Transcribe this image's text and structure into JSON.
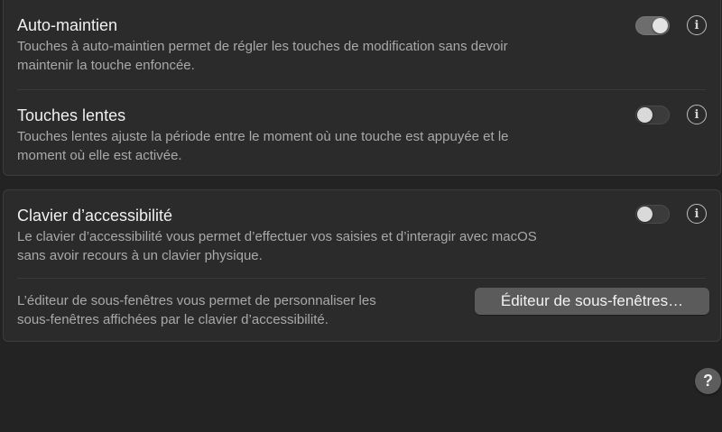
{
  "group1": {
    "sticky_keys": {
      "title": "Auto-maintien",
      "description_line1": "Touches à auto-maintien permet de régler les touches de modification sans devoir",
      "description_line2": "maintenir la touche enfoncée.",
      "enabled": true,
      "info_glyph": "i"
    },
    "slow_keys": {
      "title": "Touches lentes",
      "description_line1": "Touches lentes ajuste la période entre le moment où une touche est appuyée et le",
      "description_line2": "moment où elle est activée.",
      "enabled": false,
      "info_glyph": "i"
    }
  },
  "group2": {
    "accessibility_keyboard": {
      "title": "Clavier d’accessibilité",
      "description_line1": "Le clavier d’accessibilité vous permet d’effectuer vos saisies et d’interagir avec macOS",
      "description_line2": "sans avoir recours à un clavier physique.",
      "enabled": false,
      "info_glyph": "i"
    },
    "panel_editor": {
      "description_line1": "L’éditeur de sous-fenêtres vous permet de personnaliser les",
      "description_line2": "sous-fenêtres affichées par le clavier d’accessibilité.",
      "button_label": "Éditeur de sous-fenêtres…"
    }
  },
  "help": {
    "label": "?"
  },
  "icons": {
    "info": "info-circle-icon",
    "help": "question-mark-icon"
  }
}
